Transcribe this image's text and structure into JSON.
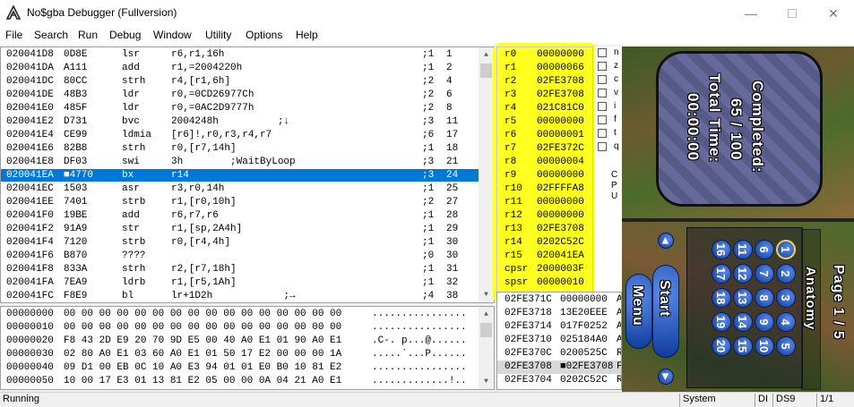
{
  "window": {
    "title": "No$gba Debugger (Fullversion)"
  },
  "menu": [
    "File",
    "Search",
    "Run",
    "Debug",
    "Window",
    "Utility",
    "Options",
    "Help"
  ],
  "disasm": [
    {
      "addr": "020041D8",
      "op": "0D8E",
      "mn": "lsr",
      "args": "r6,r1,16h",
      "cond": ";1",
      "cyc": "1"
    },
    {
      "addr": "020041DA",
      "op": "A111",
      "mn": "add",
      "args": "r1,=2004220h",
      "cond": ";1",
      "cyc": "2"
    },
    {
      "addr": "020041DC",
      "op": "80CC",
      "mn": "strh",
      "args": "r4,[r1,6h]",
      "cond": ";2",
      "cyc": "4"
    },
    {
      "addr": "020041DE",
      "op": "48B3",
      "mn": "ldr",
      "args": "r0,=0CD26977Ch",
      "cond": ";2",
      "cyc": "6"
    },
    {
      "addr": "020041E0",
      "op": "485F",
      "mn": "ldr",
      "args": "r0,=0AC2D9777h",
      "cond": ";2",
      "cyc": "8"
    },
    {
      "addr": "020041E2",
      "op": "D731",
      "mn": "bvc",
      "args": "2004248h          ;↓",
      "cond": ";3",
      "cyc": "11"
    },
    {
      "addr": "020041E4",
      "op": "CE99",
      "mn": "ldmia",
      "args": "[r6]!,r0,r3,r4,r7",
      "cond": ";6",
      "cyc": "17"
    },
    {
      "addr": "020041E6",
      "op": "82B8",
      "mn": "strh",
      "args": "r0,[r7,14h]",
      "cond": ";1",
      "cyc": "18"
    },
    {
      "addr": "020041E8",
      "op": "DF03",
      "mn": "swi",
      "args": "3h        ;WaitByLoop",
      "cond": ";3",
      "cyc": "21"
    },
    {
      "addr": "020041EA",
      "op": "■4770",
      "mn": "bx",
      "args": "r14",
      "cond": ";3",
      "cyc": "24"
    },
    {
      "addr": "020041EC",
      "op": "1503",
      "mn": "asr",
      "args": "r3,r0,14h",
      "cond": ";1",
      "cyc": "25"
    },
    {
      "addr": "020041EE",
      "op": "7401",
      "mn": "strb",
      "args": "r1,[r0,10h]",
      "cond": ";2",
      "cyc": "27"
    },
    {
      "addr": "020041F0",
      "op": "19BE",
      "mn": "add",
      "args": "r6,r7,r6",
      "cond": ";1",
      "cyc": "28"
    },
    {
      "addr": "020041F2",
      "op": "91A9",
      "mn": "str",
      "args": "r1,[sp,2A4h]",
      "cond": ";1",
      "cyc": "29"
    },
    {
      "addr": "020041F4",
      "op": "7120",
      "mn": "strb",
      "args": "r0,[r4,4h]",
      "cond": ";1",
      "cyc": "30"
    },
    {
      "addr": "020041F6",
      "op": "B870",
      "mn": "????",
      "args": "",
      "cond": ";0",
      "cyc": "30"
    },
    {
      "addr": "020041F8",
      "op": "833A",
      "mn": "strh",
      "args": "r2,[r7,18h]",
      "cond": ";1",
      "cyc": "31"
    },
    {
      "addr": "020041FA",
      "op": "7EA9",
      "mn": "ldrb",
      "args": "r1,[r5,1Ah]",
      "cond": ";1",
      "cyc": "32"
    },
    {
      "addr": "020041FC",
      "op": "F8E9",
      "mn": "bl",
      "args": "lr+1D2h            ;→",
      "cond": ";4",
      "cyc": "38"
    }
  ],
  "hex": [
    {
      "addr": "00000000",
      "bytes": "00 00 00 00 00 00 00 00 00 00 00 00 00 00 00 00",
      "ascii": "................"
    },
    {
      "addr": "00000010",
      "bytes": "00 00 00 00 00 00 00 00 00 00 00 00 00 00 00 00",
      "ascii": "................"
    },
    {
      "addr": "00000020",
      "bytes": "F8 43 2D E9 20 70 9D E5 00 40 A0 E1 01 90 A0 E1",
      "ascii": ".C-. p...@......"
    },
    {
      "addr": "00000030",
      "bytes": "02 80 A0 E1 03 60 A0 E1 01 50 17 E2 00 00 00 1A",
      "ascii": ".....`...P......"
    },
    {
      "addr": "00000040",
      "bytes": "09 D1 00 EB 0C 10 A0 E3 94 01 01 E0 B0 10 81 E2",
      "ascii": "................"
    },
    {
      "addr": "00000050",
      "bytes": "10 00 17 E3 01 13 81 E2 05 00 00 0A 04 21 A0 E1",
      "ascii": ".............!.."
    }
  ],
  "registers": [
    {
      "name": "r0",
      "val": "00000000"
    },
    {
      "name": "r1",
      "val": "00000066"
    },
    {
      "name": "r2",
      "val": "02FE3708"
    },
    {
      "name": "r3",
      "val": "02FE3708"
    },
    {
      "name": "r4",
      "val": "021C81C0"
    },
    {
      "name": "r5",
      "val": "00000000"
    },
    {
      "name": "r6",
      "val": "00000001"
    },
    {
      "name": "r7",
      "val": "02FE372C"
    },
    {
      "name": "r8",
      "val": "00000004"
    },
    {
      "name": "r9",
      "val": "00000000"
    },
    {
      "name": "r10",
      "val": "02FFFFA8"
    },
    {
      "name": "r11",
      "val": "00000000"
    },
    {
      "name": "r12",
      "val": "00000000"
    },
    {
      "name": "r13",
      "val": "02FE3708"
    },
    {
      "name": "r14",
      "val": "0202C52C"
    },
    {
      "name": "r15",
      "val": "020041EA"
    },
    {
      "name": "cpsr",
      "val": "2000003F"
    },
    {
      "name": "spsr",
      "val": "00000010"
    }
  ],
  "flags": [
    "n",
    "z",
    "c",
    "v",
    "i",
    "f",
    "t",
    "q"
  ],
  "cpu_label": [
    "C",
    "P",
    "U"
  ],
  "stack": [
    {
      "addr": "02FE371C",
      "val": "00000000",
      "tag": "A"
    },
    {
      "addr": "02FE3718",
      "val": "13E20EEE",
      "tag": "A"
    },
    {
      "addr": "02FE3714",
      "val": "017F0252",
      "tag": "A"
    },
    {
      "addr": "02FE3710",
      "val": "025184A0",
      "tag": "A"
    },
    {
      "addr": "02FE370C",
      "val": "0200525C",
      "tag": "R"
    },
    {
      "addr": "02FE3708",
      "val": "■02FE3708",
      "tag": "F"
    },
    {
      "addr": "02FE3704",
      "val": "0202C52C",
      "tag": "R"
    }
  ],
  "game": {
    "completed_label": "Completed:",
    "completed_value": "65 / 100",
    "time_label": "Total Time:",
    "time_value": "00:00:00",
    "page_label": "Page 1 / 5",
    "category": "Anatomy",
    "start_label": "Start",
    "menu_label": "Menu",
    "numbers": [
      "1",
      "2",
      "3",
      "4",
      "5",
      "6",
      "7",
      "8",
      "9",
      "10",
      "11",
      "12",
      "13",
      "14",
      "15",
      "16",
      "17",
      "18",
      "19",
      "20"
    ]
  },
  "status": {
    "state": "Running",
    "system": "System",
    "sec1": "DI",
    "sec2": "DS9",
    "frame": "1/1"
  }
}
